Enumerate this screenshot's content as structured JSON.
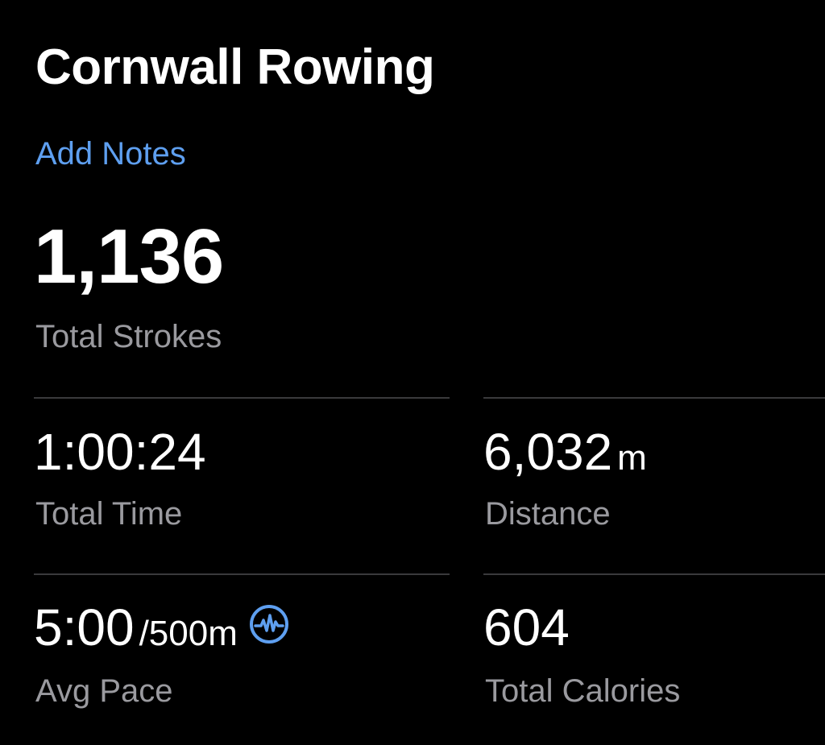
{
  "workout": {
    "title": "Cornwall Rowing",
    "add_notes": "Add Notes"
  },
  "strokes": {
    "value": "1,136",
    "label": "Total Strokes"
  },
  "metrics": {
    "time": {
      "value": "1:00:24",
      "label": "Total Time"
    },
    "distance": {
      "value": "6,032",
      "unit": "m",
      "label": "Distance"
    },
    "pace": {
      "value": "5:00",
      "unit": "/500m",
      "label": "Avg Pace",
      "icon": "waveform-circle-icon"
    },
    "calories": {
      "value": "604",
      "label": "Total Calories"
    }
  },
  "colors": {
    "background": "#000000",
    "text": "#ffffff",
    "secondary_text": "#9a9a9f",
    "accent": "#5e9ff0",
    "divider": "#3a3a3c"
  }
}
